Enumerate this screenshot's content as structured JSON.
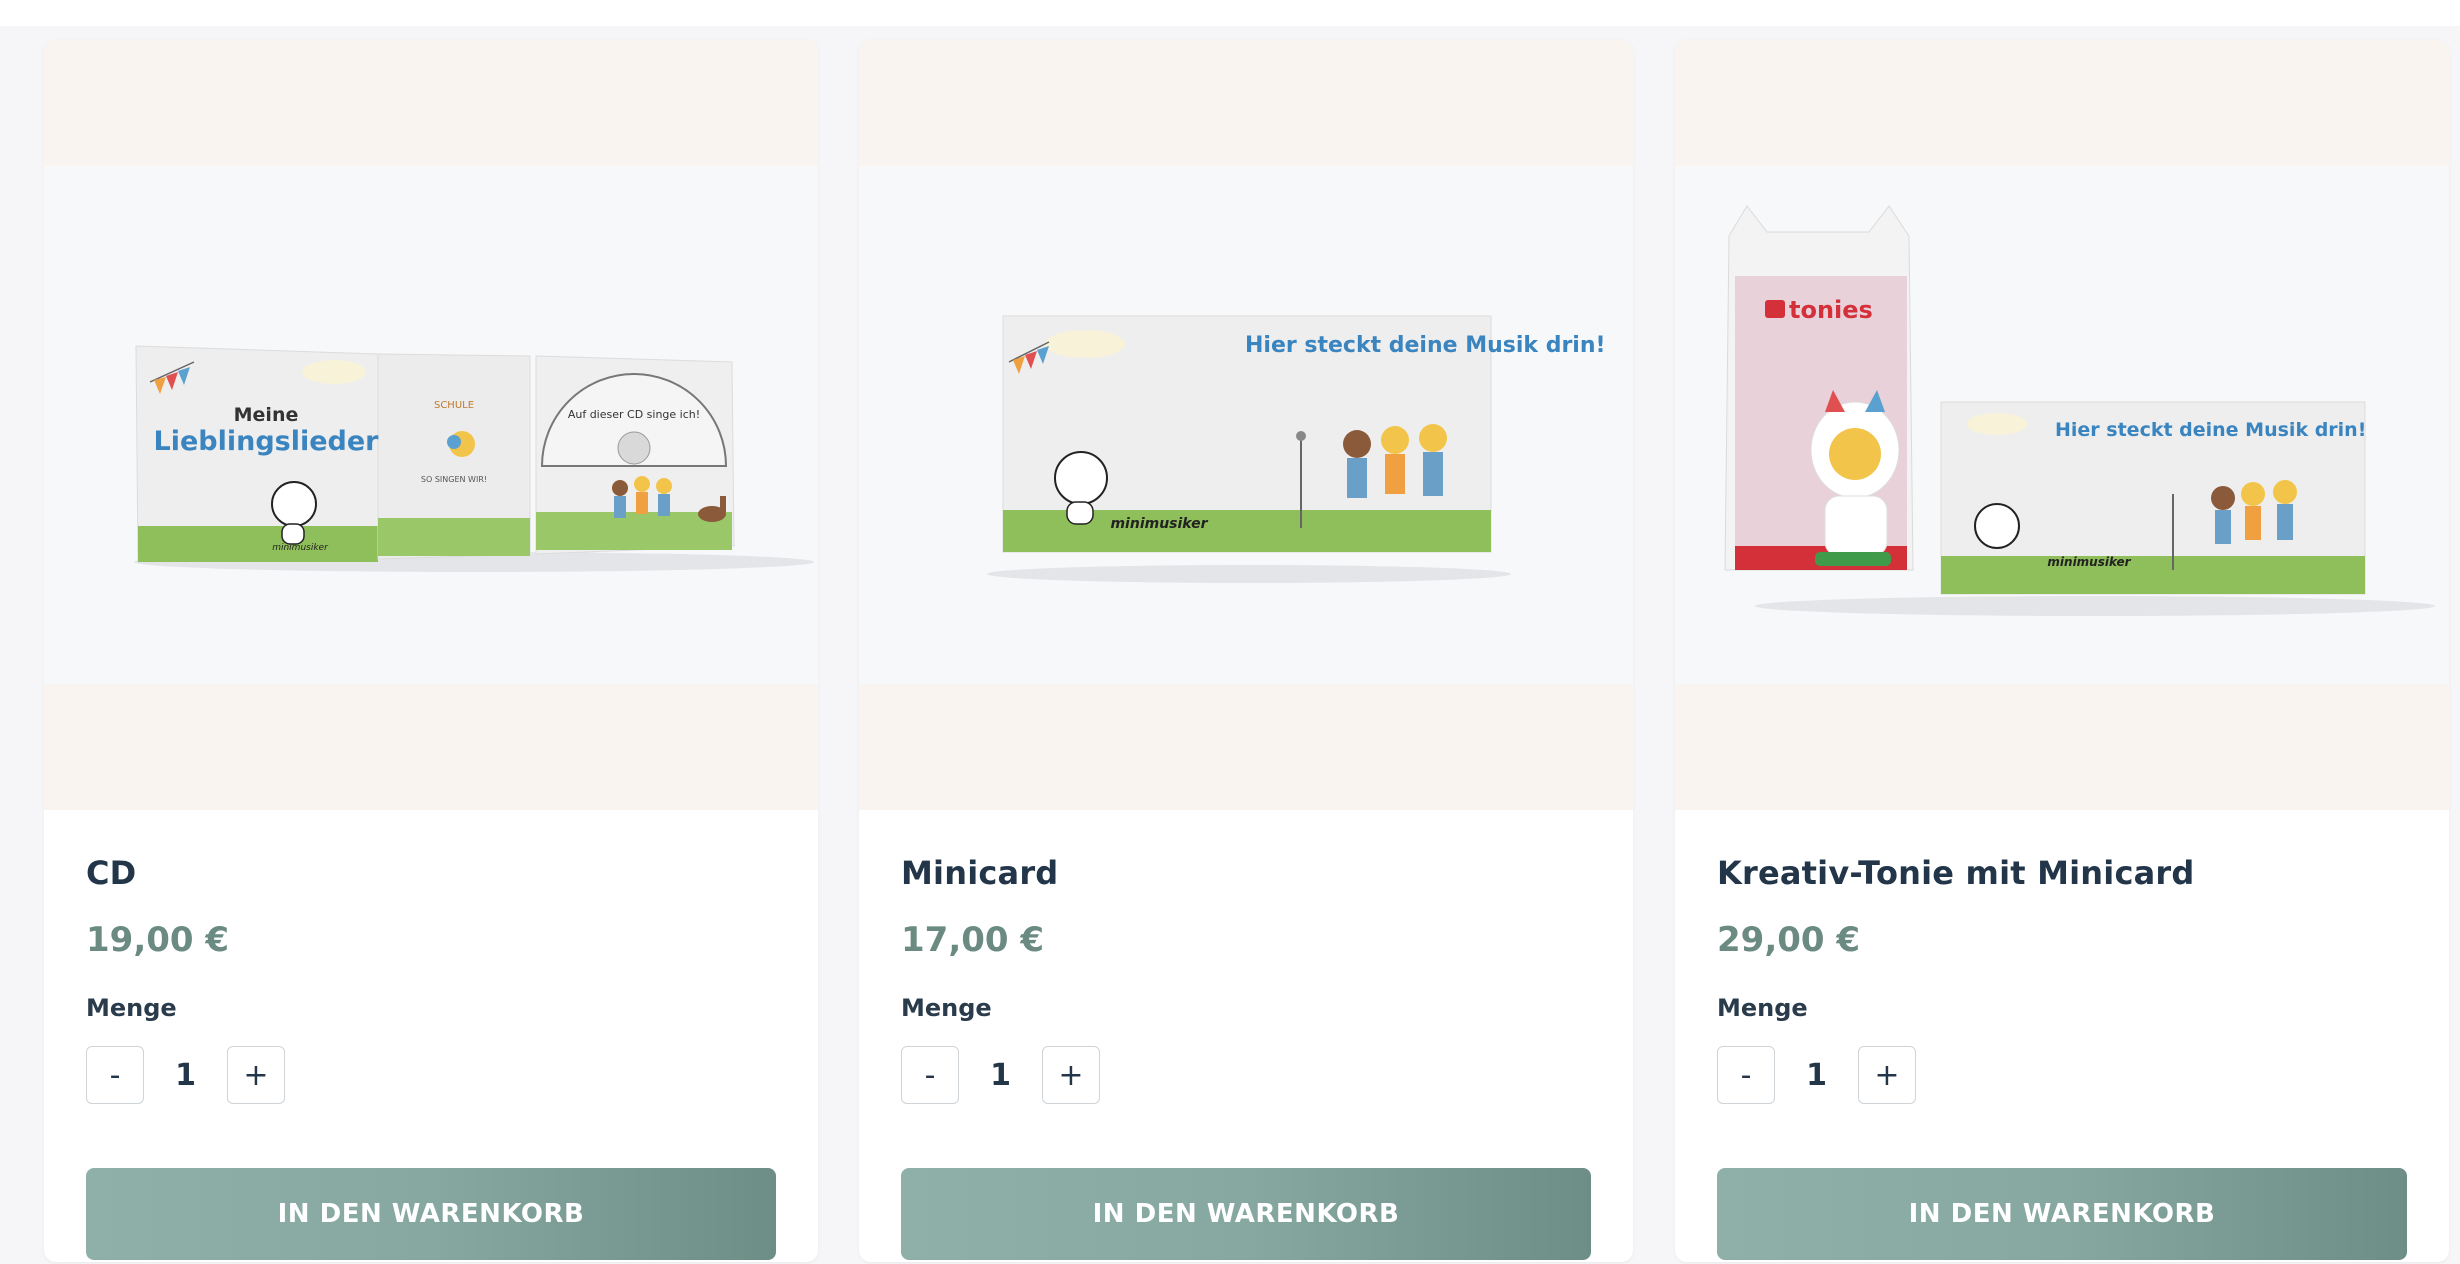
{
  "qty_label": "Menge",
  "minus_label": "-",
  "plus_label": "+",
  "cart_label": "IN DEN WARENKORB",
  "colors": {
    "title": "#223549",
    "price": "#6a8a82",
    "button": "#86a8a0",
    "media_bg": "#f9f4f0"
  },
  "products": [
    {
      "title": "CD",
      "price": "19,00 €",
      "quantity": "1",
      "image_text": {
        "line1": "Meine",
        "line2": "Lieblingslieder",
        "school": "SCHULE",
        "sing": "SO SINGEN WIR!",
        "disc": "Auf dieser CD singe ich!",
        "brand": "minimusiker"
      }
    },
    {
      "title": "Minicard",
      "price": "17,00 €",
      "quantity": "1",
      "image_text": {
        "headline": "Hier steckt deine Musik drin!",
        "brand": "minimusiker"
      }
    },
    {
      "title": "Kreativ-Tonie mit Minicard",
      "price": "29,00 €",
      "quantity": "1",
      "image_text": {
        "tonies": "tonies",
        "headline": "Hier steckt deine Musik drin!",
        "brand": "minimusiker"
      }
    }
  ]
}
